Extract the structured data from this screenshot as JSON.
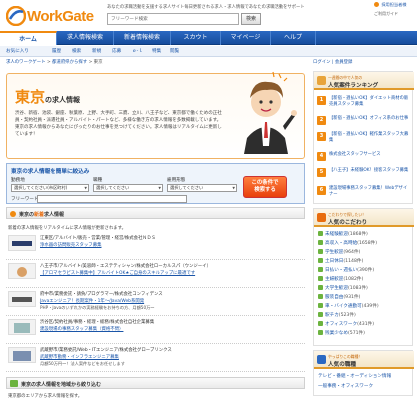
{
  "header": {
    "logo_text": "WorkGate",
    "tagline": "あなたの求職活動を支援する求人サイト毎日更新される求人・求人情報であなたの求職活動をサポート",
    "search_placeholder": "フリーワード検索",
    "search_button": "検索",
    "login_label": "採用担当者様",
    "login_sub": "ご利用ガイド"
  },
  "nav": {
    "items": [
      {
        "label": "ホーム",
        "active": true
      },
      {
        "label": "求人情報検索",
        "active": false
      },
      {
        "label": "新着情報検索",
        "active": false
      },
      {
        "label": "スカウト",
        "active": false
      },
      {
        "label": "マイページ",
        "active": false
      },
      {
        "label": "ヘルプ",
        "active": false
      }
    ]
  },
  "subnav": {
    "items": [
      "お気に入り",
      "履歴",
      "検索",
      "新規",
      "応募",
      "ｅ-ｌ",
      "特集",
      "閲覧"
    ]
  },
  "breadcrumb": {
    "home": "求人のワークゲート",
    "sep1": ">",
    "mid": "都道府県から探す",
    "sep2": ">",
    "current": "東京"
  },
  "side_links": {
    "login": "ログイン",
    "register": "会員登録"
  },
  "hero": {
    "title": "東京",
    "title_sub": "の求人情報",
    "description": "渋谷、新宿、池袋、銀座、秋葉原、上野、大手町、三鷹、立川、八王子など、東京都で働くための正社員・契約社員・派遣社員・アルバイト・パートなど、多様な働き方の求人情報を多数掲載しています。東京の求人情報からあなたにぴったりのお仕事を見つけてください。求人情報はリアルタイムに更新しています！"
  },
  "search_panel": {
    "title": "東京の求人情報を簡単に絞込み",
    "label_location": "勤務地",
    "label_occupation": "職種",
    "label_type": "雇用形態",
    "select_location": "選択してください(市区町村)",
    "select_occupation": "選択してください",
    "select_type": "選択してください",
    "label_free": "フリーワード",
    "button_line1": "この条件で",
    "button_line2": "検索する"
  },
  "new_jobs": {
    "heading_prefix": "東京の",
    "heading_highlight": "新着",
    "heading_suffix": "求人情報",
    "intro": "新着の求人情報をリアルタイムに求人情報が更新されます。",
    "items": [
      {
        "company": "江東区/アルバイト/販売・営業/管理・経営/株式会社ＮＤＳ",
        "title": "浄水器の訪問販売スタッフ募集",
        "extra": ""
      },
      {
        "company": "八王子市/アルバイト/美容師・エステティシャン/株式会社ローカルスパ（ウンジーイ）",
        "title": "【アロマセラピスト募集中】アルバイトOK★ご自身のスキルアップに最適です",
        "extra": ""
      },
      {
        "company": "府中市/業務委託・請負/プログラマー/株式会社コンフィデンス",
        "title": "Javaエンジニア！長期案件・1年～/Java/Web系開発",
        "extra": "PHP・Javaのいずれかの実務経験をお持ちの方、月額50万～"
      },
      {
        "company": "渋谷区/契約社員/事務・経理・総務/株式会社自社企業募集",
        "title": "建設現場の事務スタッフ募集（資格不問）",
        "extra": ""
      },
      {
        "company": "武蔵野市/業務委託/Web・ITエンジニア/株式会社グローブリンクス",
        "title": "武蔵野市勤務・インフラエンジニア募集",
        "extra": "月額50万円～！法人案件などをお任せします"
      }
    ]
  },
  "region": {
    "heading": "東京の求人情報を地域から絞り込む",
    "intro": "東京都のエリアから求人情報を探す。"
  },
  "ranking": {
    "small": "一週間の中で人気の",
    "title": "人気案件ランキング",
    "items": [
      "【新宿・週払いOK】ダイエット商材の販売員スタッフ募集",
      "【新宿・週払いOK】オフィス系のお仕事",
      "【新宿・週払いOK】軽作業スタッフ大募集",
      "株式会社スタッフサービス",
      "【八王子】未経験OK！接客スタッフ募集",
      "建設現場事務スタッフ募集！Webデザイナー"
    ]
  },
  "features": {
    "small": "こだわりで探したい！",
    "title": "人気のこだわり",
    "items": [
      {
        "label": "未経験歓迎",
        "count": "(1868件)"
      },
      {
        "label": "高収入・高時給",
        "count": "(1658件)"
      },
      {
        "label": "学生歓迎",
        "count": "(964件)"
      },
      {
        "label": "土日休日",
        "count": "(1148件)"
      },
      {
        "label": "日払い・週払い",
        "count": "(390件)"
      },
      {
        "label": "主婦歓迎",
        "count": "(1082件)"
      },
      {
        "label": "大学生歓迎",
        "count": "(1083件)"
      },
      {
        "label": "服装自由",
        "count": "(931件)"
      },
      {
        "label": "車・バイク通勤可",
        "count": "(439件)"
      },
      {
        "label": "駅チカ",
        "count": "(523件)"
      },
      {
        "label": "オフィスワーク",
        "count": "(431件)"
      },
      {
        "label": "残業少なめ",
        "count": "(571件)"
      }
    ]
  },
  "industry": {
    "small": "やっぱりこの職種！",
    "title": "人気の職種",
    "items": [
      "テレビ・番組・オーディション情報",
      "一般事務・オフィスワーク"
    ]
  },
  "colors": {
    "accent": "#f08a10",
    "nav": "#1a55a8",
    "search_button": "#e8400c"
  }
}
